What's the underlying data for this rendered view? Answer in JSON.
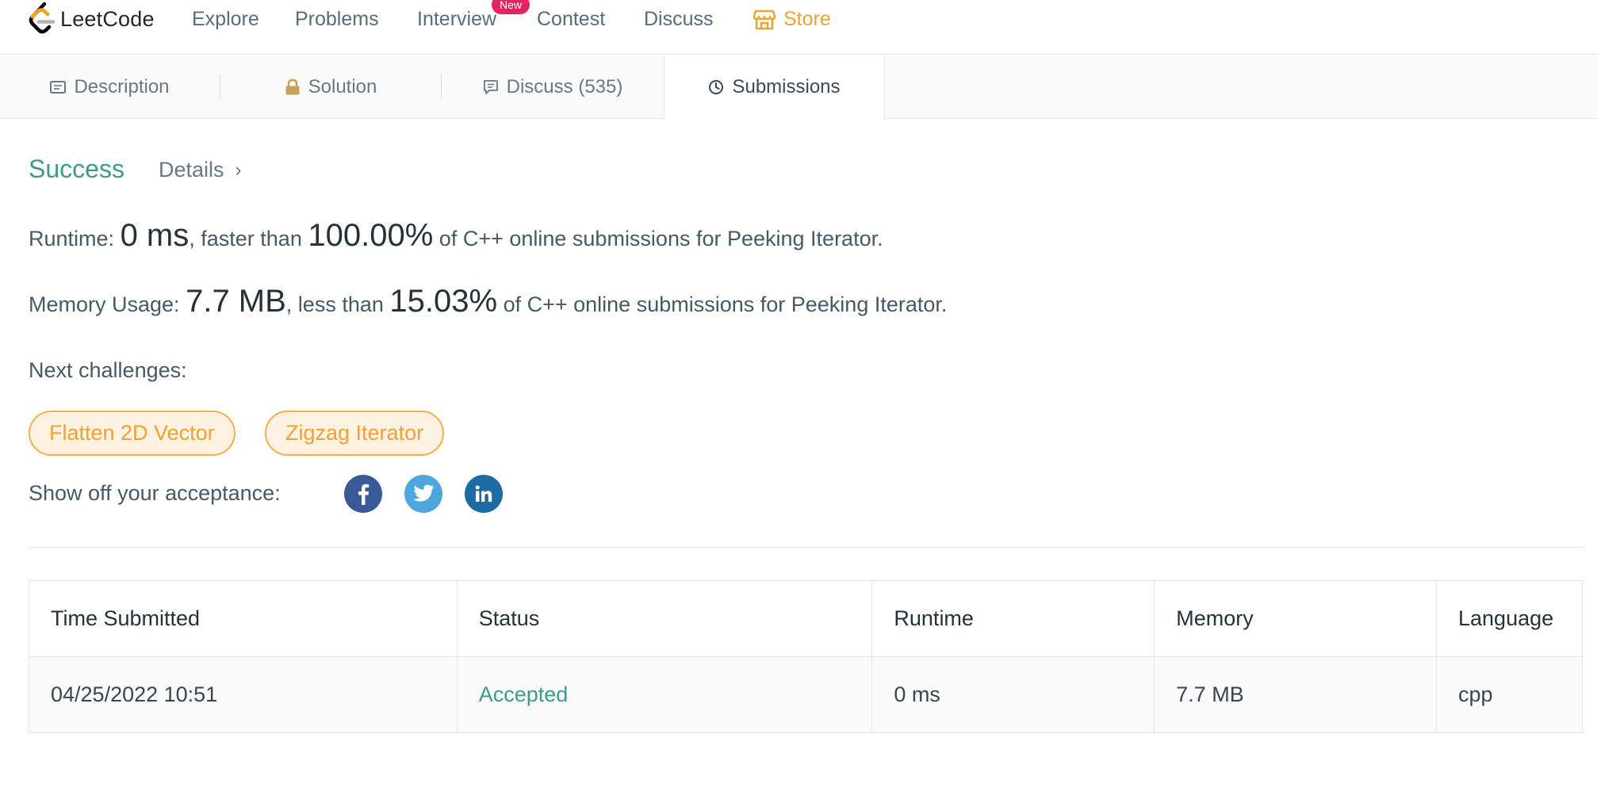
{
  "nav": {
    "logo_text": "LeetCode",
    "items": [
      "Explore",
      "Problems",
      "Interview",
      "Contest",
      "Discuss"
    ],
    "new_badge": "New",
    "store": "Store",
    "store_color": "#f0a233"
  },
  "tabs": [
    {
      "label": "Description",
      "icon": "description-icon"
    },
    {
      "label": "Solution",
      "icon": "lock-icon"
    },
    {
      "label": "Discuss (535)",
      "icon": "comment-icon"
    },
    {
      "label": "Submissions",
      "icon": "clock-icon",
      "active": true
    }
  ],
  "result": {
    "status": "Success",
    "status_color": "#3e9a8b",
    "details": "Details",
    "runtime": {
      "label": "Runtime:",
      "value": "0 ms",
      "mid": ", faster than",
      "percent": "100.00%",
      "suffix": "of C++ online submissions for Peeking Iterator."
    },
    "memory": {
      "label": "Memory Usage:",
      "value": "7.7 MB",
      "mid": ", less than",
      "percent": "15.03%",
      "suffix": "of C++ online submissions for Peeking Iterator."
    },
    "next_label": "Next challenges:",
    "challenges": [
      "Flatten 2D Vector",
      "Zigzag Iterator"
    ],
    "share_label": "Show off your acceptance:",
    "social": [
      {
        "name": "facebook-icon",
        "color": "#3b5998"
      },
      {
        "name": "twitter-icon",
        "color": "#4da7de"
      },
      {
        "name": "linkedin-icon",
        "color": "#1e6aa3"
      }
    ]
  },
  "table": {
    "headers": [
      "Time Submitted",
      "Status",
      "Runtime",
      "Memory",
      "Language"
    ],
    "rows": [
      [
        "04/25/2022 10:51",
        "Accepted",
        "0 ms",
        "7.7 MB",
        "cpp"
      ]
    ]
  }
}
